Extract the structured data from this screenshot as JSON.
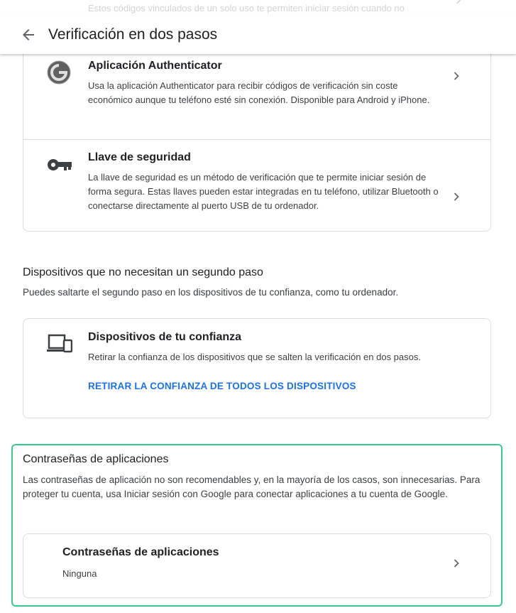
{
  "ghost": {
    "text": "Estos códigos vinculados de un solo uso te permiten iniciar sesión cuando no tengas el teléfono a mano. Guárdalos en un lugar seguro."
  },
  "header": {
    "title": "Verificación en dos pasos",
    "back_icon": "arrow-back-icon"
  },
  "methods": [
    {
      "title": "Aplicación Authenticator",
      "description": "Usa la aplicación Authenticator para recibir códigos de verificación sin coste económico aunque tu teléfono esté sin conexión. Disponible para Android y iPhone.",
      "icon": "authenticator-icon"
    },
    {
      "title": "Llave de seguridad",
      "description": "La llave de seguridad es un método de verificación que te permite iniciar sesión de forma segura. Estas llaves pueden estar integradas en tu teléfono, utilizar Bluetooth o conectarse directamente al puerto USB de tu ordenador.",
      "icon": "key-icon"
    }
  ],
  "devices_section": {
    "title": "Dispositivos que no necesitan un segundo paso",
    "description": "Puedes saltarte el segundo paso en los dispositivos de tu confianza, como tu ordenador.",
    "card": {
      "title": "Dispositivos de tu confianza",
      "description": "Retirar la confianza de los dispositivos que se salten la verificación en dos pasos.",
      "action": "RETIRAR LA CONFIANZA DE TODOS LOS DISPOSITIVOS",
      "icon": "devices-icon"
    }
  },
  "app_passwords": {
    "title": "Contraseñas de aplicaciones",
    "description": "Las contraseñas de aplicación no son recomendables y, en la mayoría de los casos, son innecesarias. Para proteger tu cuenta, usa Iniciar sesión con Google para conectar aplicaciones a tu cuenta de Google.",
    "card": {
      "title": "Contraseñas de aplicaciones",
      "value": "Ninguna"
    }
  },
  "colors": {
    "link": "#1a73e8",
    "highlight_border": "#33cc8c",
    "card_border": "#dadce0"
  }
}
